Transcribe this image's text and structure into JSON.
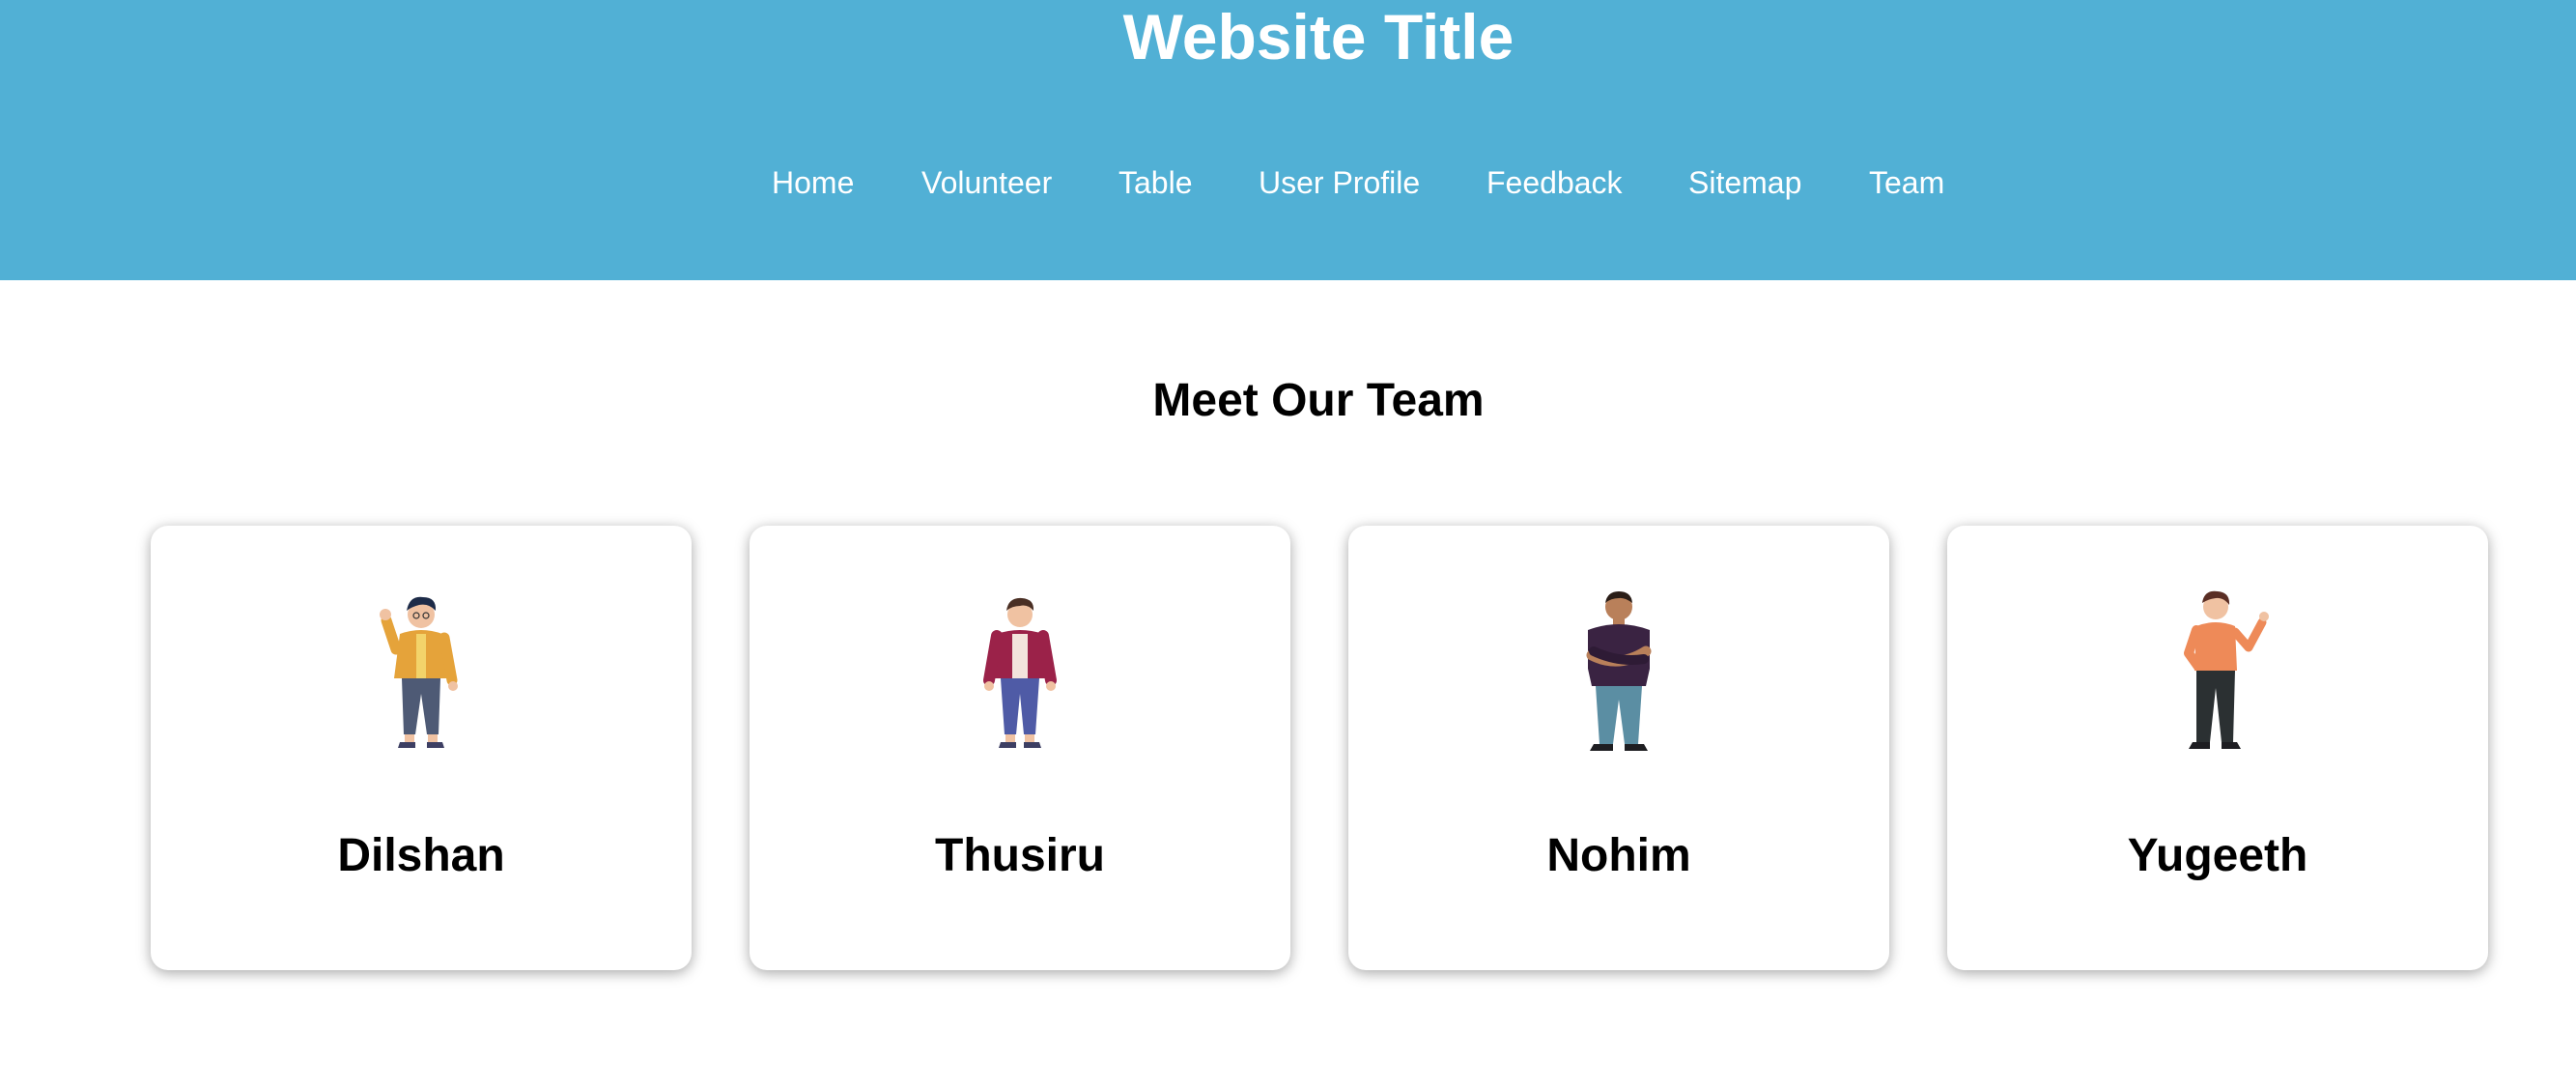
{
  "header": {
    "title": "Website Title",
    "background": "#51b0d5",
    "nav": [
      "Home",
      "Volunteer",
      "Table",
      "User Profile",
      "Feedback",
      "Sitemap",
      "Team"
    ]
  },
  "team": {
    "heading": "Meet Our Team",
    "members": [
      {
        "name": "Dilshan",
        "avatar": "person-waving-yellow-jacket-icon"
      },
      {
        "name": "Thusiru",
        "avatar": "person-standing-red-jacket-icon"
      },
      {
        "name": "Nohim",
        "avatar": "person-arms-crossed-purple-shirt-icon"
      },
      {
        "name": "Yugeeth",
        "avatar": "person-waving-orange-shirt-icon"
      }
    ]
  }
}
